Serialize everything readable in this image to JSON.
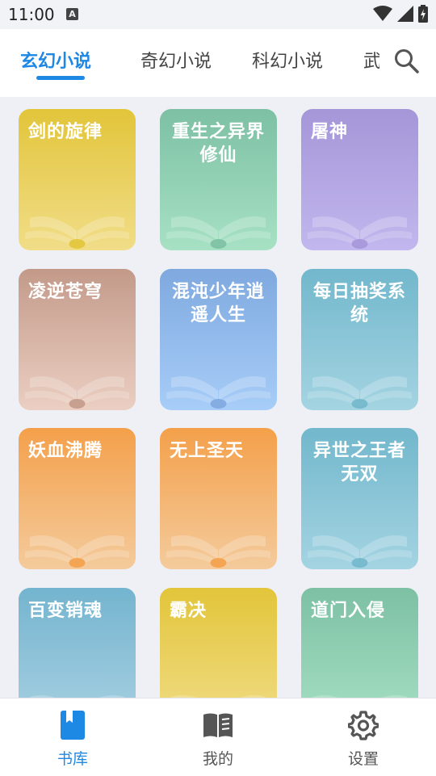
{
  "status_bar": {
    "time": "11:00",
    "notification_badge": "A"
  },
  "tabs": [
    {
      "label": "玄幻小说",
      "active": true
    },
    {
      "label": "奇幻小说",
      "active": false
    },
    {
      "label": "科幻小说",
      "active": false
    },
    {
      "label": "武",
      "active": false
    }
  ],
  "books": [
    {
      "title": "剑的旋律",
      "color_top": "#e2c53a",
      "color_bottom": "#f1dd88"
    },
    {
      "title": "重生之异界修仙",
      "color_top": "#7dc0a4",
      "color_bottom": "#a7e1c4"
    },
    {
      "title": "屠神",
      "color_top": "#a596d8",
      "color_bottom": "#c2b7ee"
    },
    {
      "title": "凌逆苍穹",
      "color_top": "#c39a8a",
      "color_bottom": "#ebcfc2"
    },
    {
      "title": "混沌少年逍遥人生",
      "color_top": "#7fa9df",
      "color_bottom": "#a7cdf8"
    },
    {
      "title": "每日抽奖系统",
      "color_top": "#72b7cc",
      "color_bottom": "#a4d4e2"
    },
    {
      "title": "妖血沸腾",
      "color_top": "#f4a04a",
      "color_bottom": "#f4cb9c"
    },
    {
      "title": "无上圣天",
      "color_top": "#f4a04a",
      "color_bottom": "#f4cb9c"
    },
    {
      "title": "异世之王者无双",
      "color_top": "#72b7cc",
      "color_bottom": "#a4d4e2"
    },
    {
      "title": "百变销魂",
      "color_top": "#74b4cf",
      "color_bottom": "#a9d1e2"
    },
    {
      "title": "霸决",
      "color_top": "#e2c53a",
      "color_bottom": "#f1dd88"
    },
    {
      "title": "道门入侵",
      "color_top": "#7dc0a4",
      "color_bottom": "#a7e1c4"
    }
  ],
  "bottom_nav": [
    {
      "label": "书库",
      "icon": "bookmark-icon",
      "active": true
    },
    {
      "label": "我的",
      "icon": "open-book-icon",
      "active": false
    },
    {
      "label": "设置",
      "icon": "gear-icon",
      "active": false
    }
  ],
  "colors": {
    "accent": "#1e88e5"
  }
}
